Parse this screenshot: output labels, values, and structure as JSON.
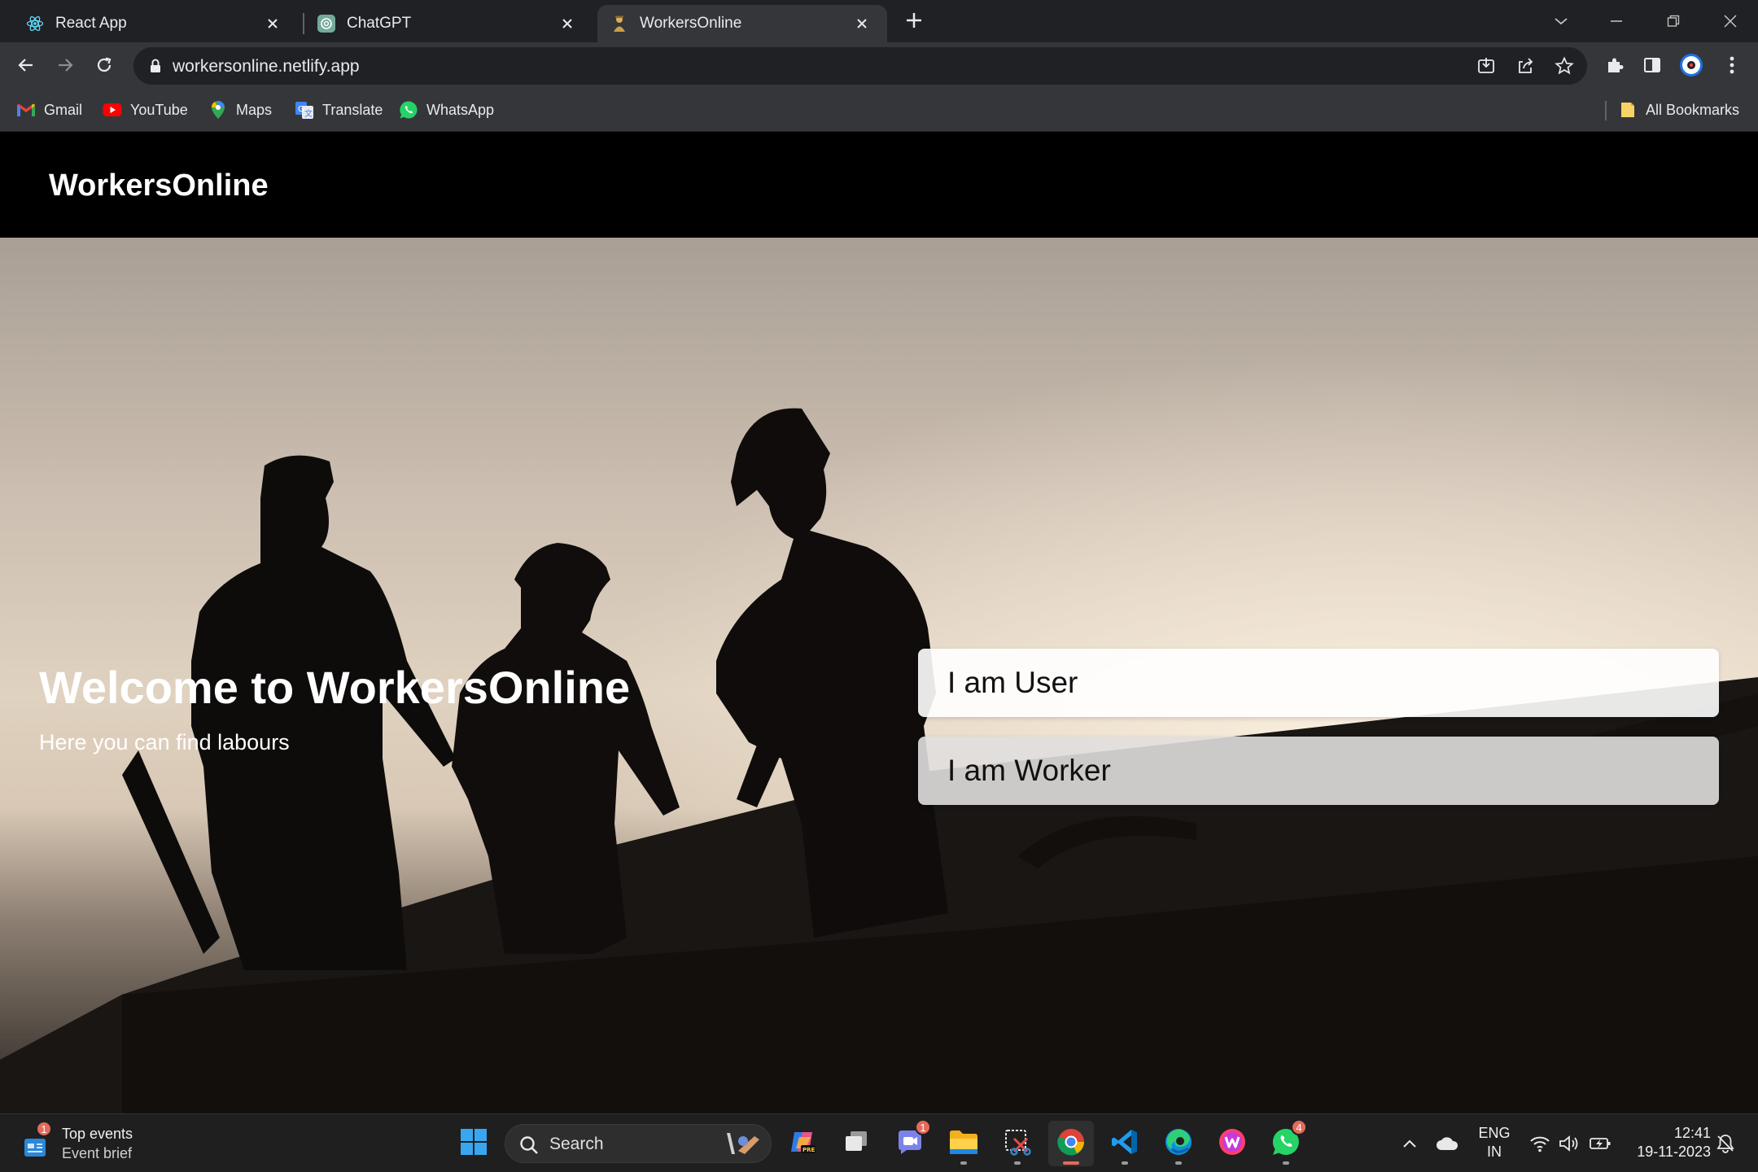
{
  "browser": {
    "tabs": [
      {
        "title": "React App",
        "favicon": "react-icon",
        "active": false
      },
      {
        "title": "ChatGPT",
        "favicon": "chatgpt-icon",
        "active": false
      },
      {
        "title": "WorkersOnline",
        "favicon": "workersonline-icon",
        "active": true
      }
    ],
    "url": "workersonline.netlify.app",
    "bookmarks": [
      {
        "label": "Gmail",
        "icon": "gmail-icon"
      },
      {
        "label": "YouTube",
        "icon": "youtube-icon"
      },
      {
        "label": "Maps",
        "icon": "maps-icon"
      },
      {
        "label": "Translate",
        "icon": "translate-icon"
      },
      {
        "label": "WhatsApp",
        "icon": "whatsapp-icon"
      }
    ],
    "all_bookmarks": "All Bookmarks"
  },
  "page": {
    "brand": "WorkersOnline",
    "hero": {
      "title": "Welcome to WorkersOnline",
      "subtitle": "Here you can find labours"
    },
    "choices": {
      "user": "I am User",
      "worker": "I am Worker"
    }
  },
  "taskbar": {
    "weather": {
      "title": "Top events",
      "subtitle": "Event brief",
      "badge": "1"
    },
    "search_placeholder": "Search",
    "apps": [
      {
        "name": "copilot",
        "icon": "copilot-icon",
        "badge": "",
        "running": false
      },
      {
        "name": "task-view",
        "icon": "task-view-icon",
        "badge": "",
        "running": false
      },
      {
        "name": "teams",
        "icon": "teams-chat-icon",
        "badge": "1",
        "running": false
      },
      {
        "name": "file-explorer",
        "icon": "folder-icon",
        "badge": "",
        "running": true
      },
      {
        "name": "snipping-tool",
        "icon": "snipping-tool-icon",
        "badge": "",
        "running": true
      },
      {
        "name": "chrome",
        "icon": "chrome-icon",
        "badge": "",
        "running": true,
        "active": true
      },
      {
        "name": "vscode",
        "icon": "vscode-icon",
        "badge": "",
        "running": true
      },
      {
        "name": "edge",
        "icon": "edge-icon",
        "badge": "",
        "running": true
      },
      {
        "name": "wps-office",
        "icon": "wps-icon",
        "badge": "",
        "running": false
      },
      {
        "name": "whatsapp",
        "icon": "whatsapp-icon",
        "badge": "4",
        "running": true
      }
    ],
    "language": {
      "line1": "ENG",
      "line2": "IN"
    },
    "clock": {
      "time": "12:41",
      "date": "19-11-2023"
    }
  },
  "colors": {
    "chrome_dark": "#202124",
    "chrome_toolbar": "#35363a",
    "navbar": "#000000",
    "taskbar": "#1f1f1f",
    "badge": "#e46a5a"
  }
}
